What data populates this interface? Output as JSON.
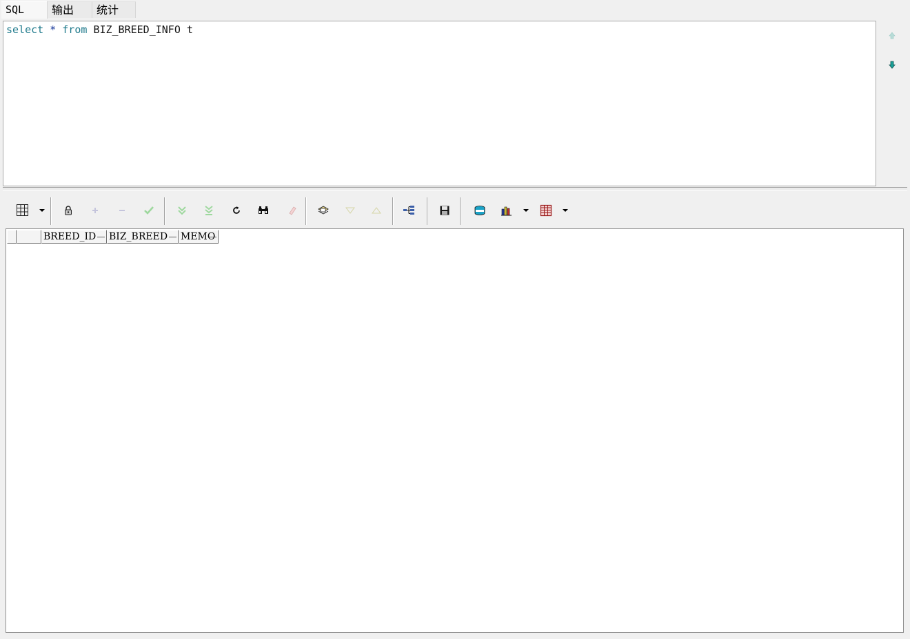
{
  "tabs": [
    {
      "label": "SQL",
      "active": true
    },
    {
      "label": "输出",
      "active": false
    },
    {
      "label": "统计",
      "active": false
    }
  ],
  "editor": {
    "keyword_select": "select",
    "operator_star": "*",
    "keyword_from": "from",
    "table_name": "BIZ_BREED_INFO",
    "alias": "t"
  },
  "side_nav": {
    "up_icon": "arrow-up-icon",
    "down_icon": "arrow-down-icon"
  },
  "toolbar": {
    "buttons": [
      {
        "icon": "grid-layout-icon",
        "dropdown": true
      },
      {
        "icon": "lock-icon"
      },
      {
        "icon": "plus-icon",
        "disabled": true
      },
      {
        "icon": "minus-icon",
        "disabled": true
      },
      {
        "icon": "check-icon",
        "disabled": true
      },
      {
        "icon": "fetch-next-icon",
        "disabled": true
      },
      {
        "icon": "fetch-last-icon",
        "disabled": true
      },
      {
        "icon": "refresh-icon"
      },
      {
        "icon": "binoculars-icon"
      },
      {
        "icon": "eraser-icon",
        "disabled": true
      },
      {
        "icon": "query-by-example-icon"
      },
      {
        "icon": "sort-down-icon",
        "disabled": true
      },
      {
        "icon": "sort-up-icon",
        "disabled": true
      },
      {
        "icon": "tree-icon"
      },
      {
        "icon": "save-icon"
      },
      {
        "icon": "export-icon"
      },
      {
        "icon": "chart-icon",
        "dropdown": true
      },
      {
        "icon": "table-icon",
        "dropdown": true
      }
    ]
  },
  "grid": {
    "columns": [
      "BREED_ID",
      "BIZ_BREED",
      "MEMO"
    ],
    "rows": []
  },
  "colors": {
    "sql_keyword": "#1f7a8c",
    "sql_operator": "#1c3c9c"
  }
}
